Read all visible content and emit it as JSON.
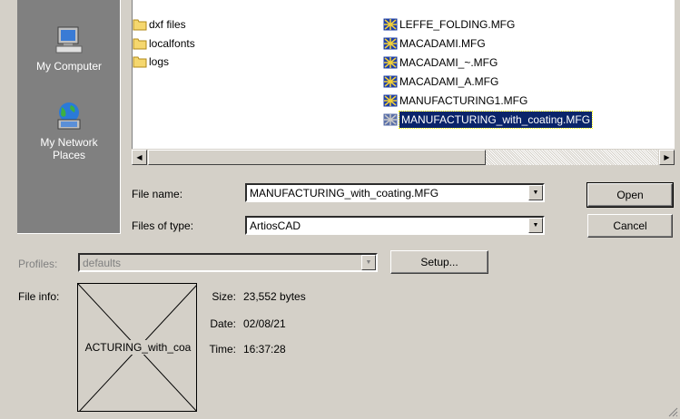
{
  "places": [
    {
      "label": "My Computer",
      "icon": "my-computer-icon"
    },
    {
      "label": "My Network Places",
      "icon": "network-places-icon"
    }
  ],
  "folders": [
    "dxf files",
    "localfonts",
    "logs"
  ],
  "files": [
    "LEFFE_FOLDING.MFG",
    "MACADAMI.MFG",
    "MACADAMI_~.MFG",
    "MACADAMI_A.MFG",
    "MANUFACTURING1.MFG",
    "MANUFACTURING_with_coating.MFG"
  ],
  "selected_file": "MANUFACTURING_with_coating.MFG",
  "file_name": {
    "label": "File name:",
    "value": "MANUFACTURING_with_coating.MFG"
  },
  "file_type": {
    "label": "Files of type:",
    "value": "ArtiosCAD"
  },
  "buttons": {
    "open": "Open",
    "cancel": "Cancel",
    "setup": "Setup..."
  },
  "profiles": {
    "label": "Profiles:",
    "value": "defaults"
  },
  "file_info": {
    "label": "File info:",
    "preview_text": "ACTURING_with_coa",
    "size_label": "Size:",
    "size": "23,552 bytes",
    "date_label": "Date:",
    "date": "02/08/21",
    "time_label": "Time:",
    "time": "16:37:28"
  },
  "colors": {
    "selection": "#0a246a",
    "face": "#d4d0c8",
    "places_bar": "#808080"
  }
}
